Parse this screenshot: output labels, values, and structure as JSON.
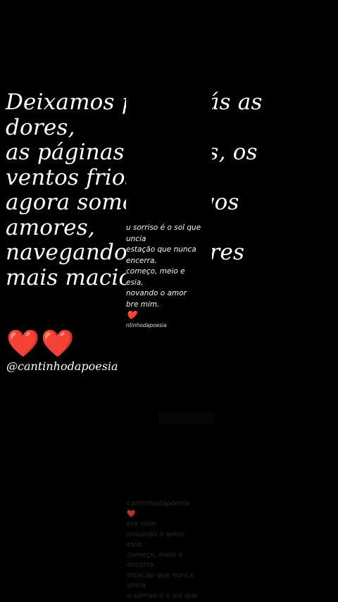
{
  "poem": {
    "lines": [
      "Deixamos p          ara trás as",
      "dores,",
      "as páginas t          tristes, os",
      "ventos frios          s,",
      "agora somo          os novos",
      "amores,",
      "navegando          em mares",
      "mais macio          os."
    ]
  },
  "hearts": "❤️❤️",
  "handle": "@cantinhodapoesia",
  "overlay": {
    "lines": [
      "u sorriso é o sol que",
      "uncia",
      "estação que nunca",
      " encerra.",
      " começo, meio e",
      "esia,",
      " novando o amor",
      "bre mim."
    ],
    "heart": "❤️",
    "tag": "ntinhodapoesia"
  },
  "ghost": {
    "lines": [
      "cantinhodapoesia",
      "❤️",
      "bre mim.",
      " novando o amor",
      "esia,",
      " começo, meio e",
      " encerra.",
      "estação que nunca",
      "uncia",
      "u sorriso é o sol que"
    ]
  }
}
